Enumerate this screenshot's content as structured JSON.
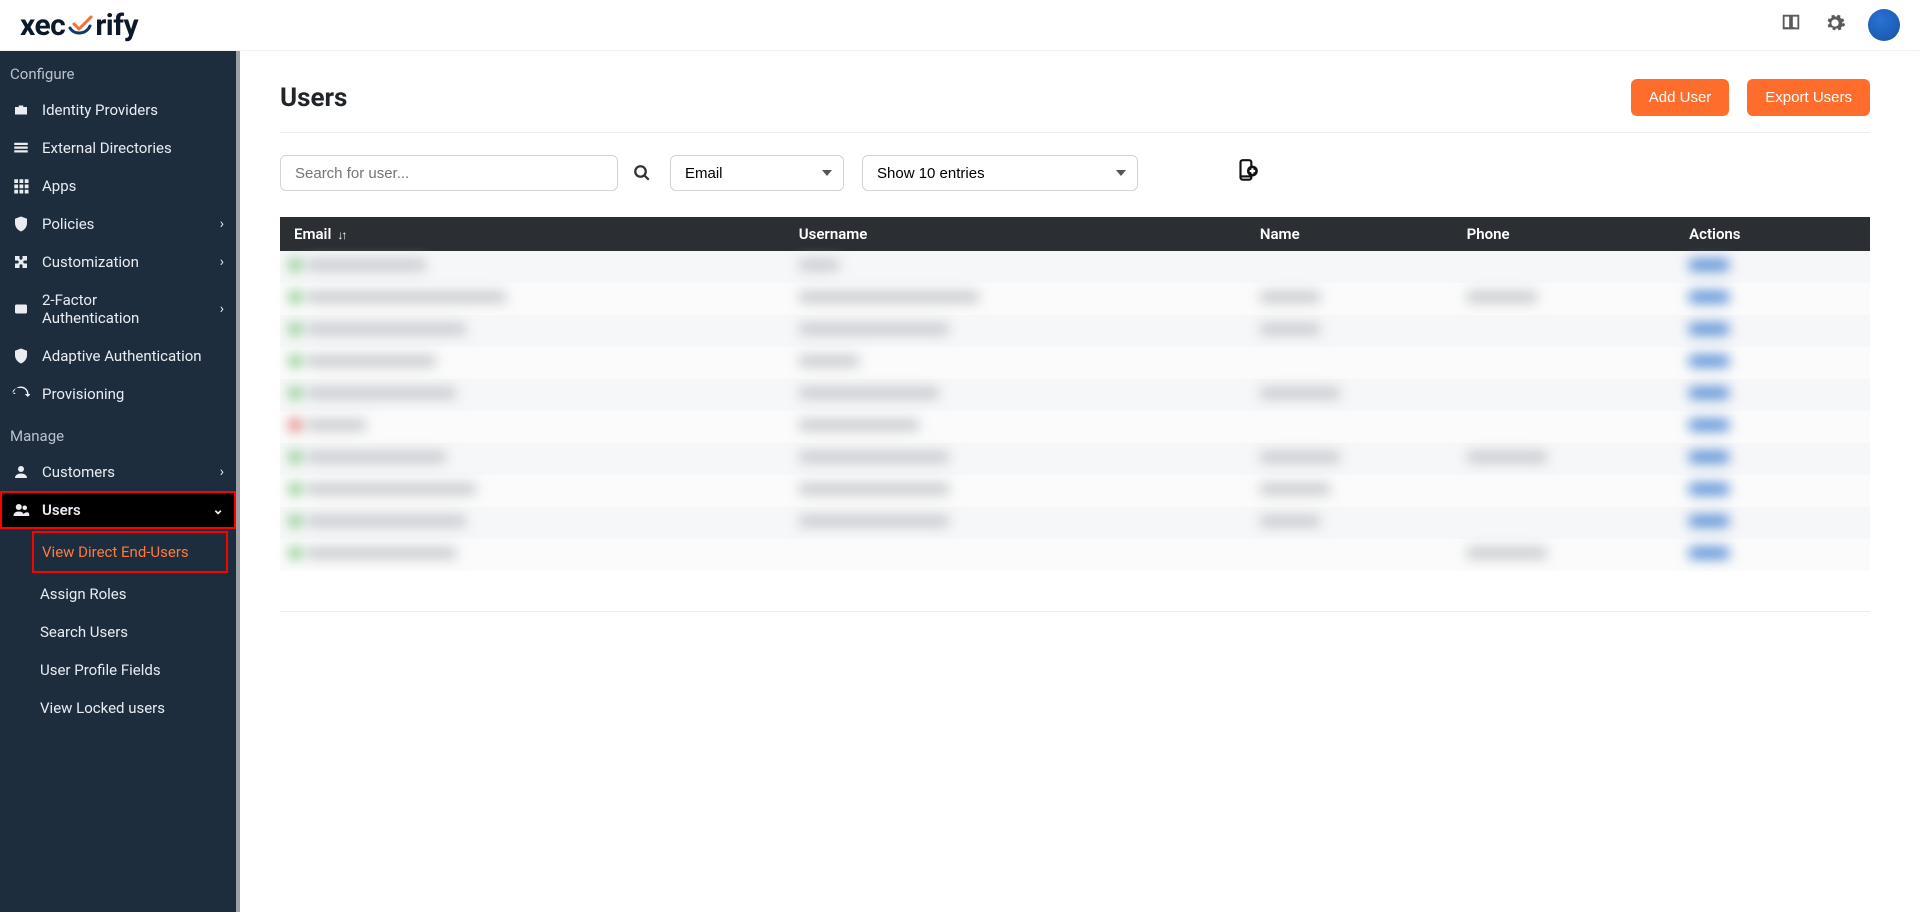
{
  "brand": {
    "name_left": "xec",
    "name_right": "rify"
  },
  "topbar": {
    "icons": {
      "book": "book-icon",
      "gear": "gear-icon",
      "avatar": "avatar"
    }
  },
  "sidebar": {
    "sections": {
      "configure_label": "Configure",
      "manage_label": "Manage"
    },
    "items": {
      "identity_providers": "Identity Providers",
      "external_directories": "External Directories",
      "apps": "Apps",
      "policies": "Policies",
      "customization": "Customization",
      "two_factor": "2-Factor Authentication",
      "adaptive_auth": "Adaptive Authentication",
      "provisioning": "Provisioning",
      "customers": "Customers",
      "users": "Users"
    },
    "users_sub": {
      "view_direct": "View Direct End-Users",
      "assign_roles": "Assign Roles",
      "search_users": "Search Users",
      "profile_fields": "User Profile Fields",
      "locked_users": "View Locked users"
    }
  },
  "page": {
    "title": "Users",
    "add_user": "Add User",
    "export_users": "Export Users"
  },
  "filters": {
    "search_placeholder": "Search for user...",
    "filter_selected": "Email",
    "entries_selected": "Show 10 entries"
  },
  "table": {
    "headers": {
      "email": "Email",
      "username": "Username",
      "name": "Name",
      "phone": "Phone",
      "actions": "Actions"
    },
    "rows": [
      {
        "status": "green",
        "email_w": 120,
        "username_w": 40,
        "name_w": 0,
        "phone_w": 0,
        "actions_w": 40
      },
      {
        "status": "green",
        "email_w": 200,
        "username_w": 180,
        "name_w": 60,
        "phone_w": 70,
        "actions_w": 40
      },
      {
        "status": "green",
        "email_w": 160,
        "username_w": 150,
        "name_w": 60,
        "phone_w": 0,
        "actions_w": 40
      },
      {
        "status": "green",
        "email_w": 130,
        "username_w": 60,
        "name_w": 0,
        "phone_w": 0,
        "actions_w": 40
      },
      {
        "status": "green",
        "email_w": 150,
        "username_w": 140,
        "name_w": 80,
        "phone_w": 0,
        "actions_w": 40
      },
      {
        "status": "red",
        "email_w": 60,
        "username_w": 120,
        "name_w": 0,
        "phone_w": 0,
        "actions_w": 40
      },
      {
        "status": "green",
        "email_w": 140,
        "username_w": 150,
        "name_w": 80,
        "phone_w": 80,
        "actions_w": 40
      },
      {
        "status": "green",
        "email_w": 170,
        "username_w": 150,
        "name_w": 70,
        "phone_w": 0,
        "actions_w": 40
      },
      {
        "status": "green",
        "email_w": 160,
        "username_w": 150,
        "name_w": 60,
        "phone_w": 0,
        "actions_w": 40
      },
      {
        "status": "green",
        "email_w": 150,
        "username_w": 0,
        "name_w": 0,
        "phone_w": 80,
        "actions_w": 40
      }
    ]
  }
}
